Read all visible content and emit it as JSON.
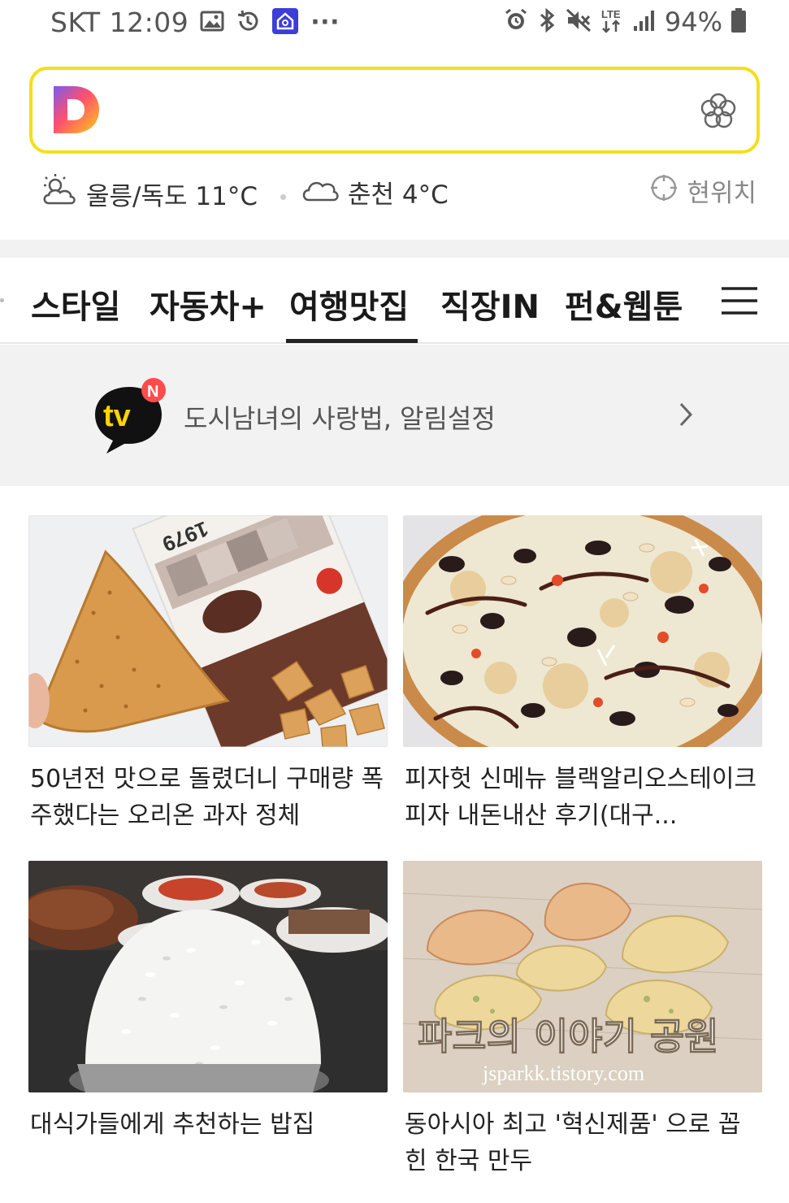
{
  "status_bar": {
    "carrier_time": "SKT 12:09",
    "more": "···",
    "network": "LTE",
    "battery": "94%"
  },
  "search": {
    "logo_letter": "D"
  },
  "weather": {
    "item1": "울릉/독도 11°C",
    "item2": "춘천 4°C",
    "location": "현위치"
  },
  "tabs": [
    "스타일",
    "자동차+",
    "여행맛집",
    "직장IN",
    "펀&웹툰"
  ],
  "tv": {
    "logo": "tv",
    "badge": "N",
    "text": "도시남녀의 사랑법, 알림설정"
  },
  "cards": [
    {
      "caption": "50년전 맛으로 돌렸더니 구매량 폭주했다는 오리온 과자 정체"
    },
    {
      "caption": "피자헛 신메뉴 블랙알리오스테이크 피자 내돈내산 후기(대구..."
    },
    {
      "caption": "대식가들에게 추천하는 밥집"
    },
    {
      "caption": "동아시아 최고 '혁신제품' 으로 꼽힌 한국 만두"
    }
  ],
  "image_text": {
    "snack_bag": "1979",
    "dumpling_title": "파크의 이야기 공원",
    "dumpling_url": "jsparkk.tistory.com"
  },
  "colors": {
    "accent_yellow": "#f5de1a",
    "band_gray": "#f2f2f2",
    "tv_badge_red": "#ff4b4b"
  }
}
